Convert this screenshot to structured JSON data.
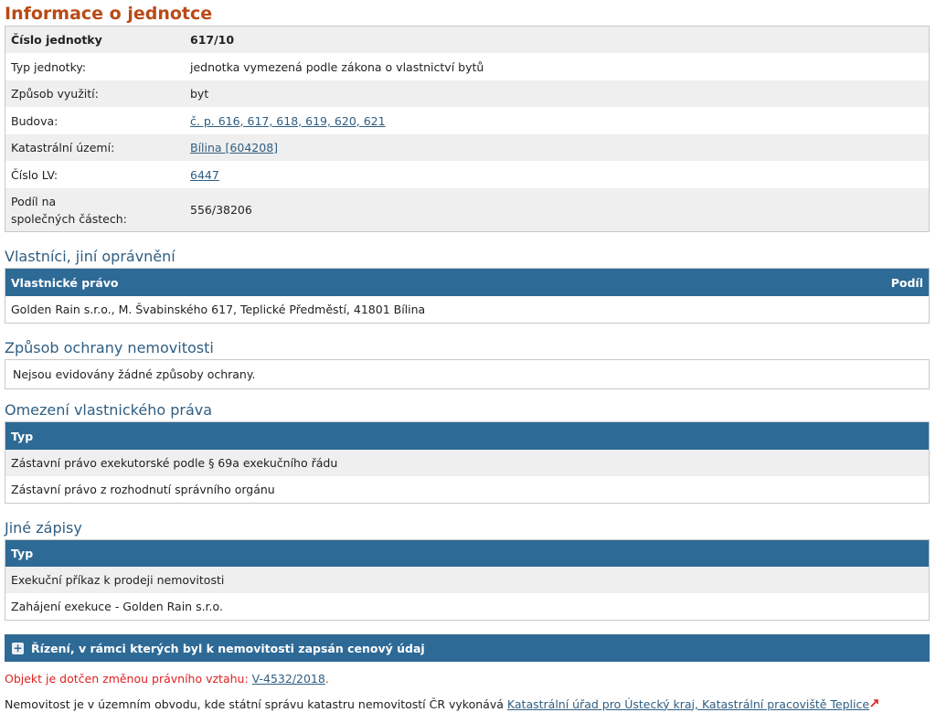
{
  "page_title": "Informace o jednotce",
  "info": [
    {
      "key": "Číslo jednotky",
      "value": "617/10"
    },
    {
      "key": "Typ jednotky:",
      "value": "jednotka vymezená podle zákona o vlastnictví bytů"
    },
    {
      "key": "Způsob využití:",
      "value": "byt"
    },
    {
      "key": "Budova:",
      "value": "č. p. 616, 617, 618, 619, 620, 621"
    },
    {
      "key": "Katastrální území:",
      "value": "Bílina [604208]"
    },
    {
      "key": "Číslo LV:",
      "value": "6447"
    },
    {
      "key_line1": "Podíl na",
      "key_line2": "společných částech:",
      "value": "556/38206"
    }
  ],
  "owners": {
    "title": "Vlastníci, jiní oprávnění",
    "col_left": "Vlastnické právo",
    "col_right": "Podíl",
    "rows": [
      "Golden Rain s.r.o., M. Švabinského 617, Teplické Předměstí, 41801 Bílina"
    ]
  },
  "protection": {
    "title": "Způsob ochrany nemovitosti",
    "text": "Nejsou evidovány žádné způsoby ochrany."
  },
  "restrictions": {
    "title": "Omezení vlastnického práva",
    "col": "Typ",
    "rows": [
      "Zástavní právo exekutorské podle § 69a exekučního řádu",
      "Zástavní právo z rozhodnutí správního orgánu"
    ]
  },
  "other": {
    "title": "Jiné zápisy",
    "col": "Typ",
    "rows": [
      "Exekuční příkaz k prodeji nemovitosti",
      "Zahájení exekuce - Golden Rain s.r.o."
    ]
  },
  "proceedings_label": "Řízení, v rámci kterých byl k nemovitosti zapsán cenový údaj",
  "notice": {
    "text": "Objekt je dotčen změnou právního vztahu:",
    "link": "V-4532/2018",
    "after": "."
  },
  "footer": {
    "text": "Nemovitost je v územním obvodu, kde státní správu katastru nemovitostí ČR vykonává",
    "link": "Katastrální úřad pro Ústecký kraj, Katastrální pracoviště Teplice",
    "ext_icon": "external-link-icon"
  },
  "colors": {
    "title": "#b94a16",
    "header_bg": "#2e6a96",
    "link": "#2f5e82",
    "alert": "#e02020"
  }
}
